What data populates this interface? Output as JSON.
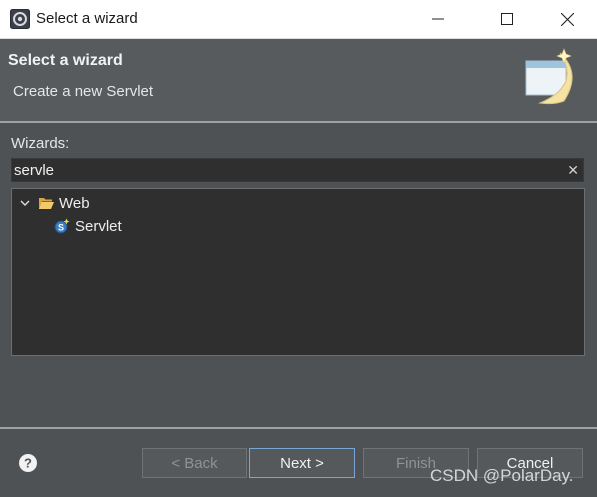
{
  "window": {
    "title": "Select a wizard",
    "icon": "eclipse-app-icon"
  },
  "header": {
    "title": "Select a wizard",
    "description": "Create a new Servlet",
    "banner_icon": "wizard-banner-icon"
  },
  "wizards": {
    "label": "Wizards:",
    "filter_value": "servle",
    "clear_icon": "✕",
    "tree": [
      {
        "label": "Web",
        "expanded": true,
        "icon": "folder-open-icon",
        "children": [
          {
            "label": "Servlet",
            "icon": "servlet-icon"
          }
        ]
      }
    ]
  },
  "footer": {
    "help_icon": "help-icon",
    "buttons": {
      "back": {
        "label": "< Back",
        "enabled": false
      },
      "next": {
        "label": "Next >",
        "enabled": true
      },
      "finish": {
        "label": "Finish",
        "enabled": false
      },
      "cancel": {
        "label": "Cancel",
        "enabled": true
      }
    }
  },
  "watermark": "CSDN @PolarDay."
}
